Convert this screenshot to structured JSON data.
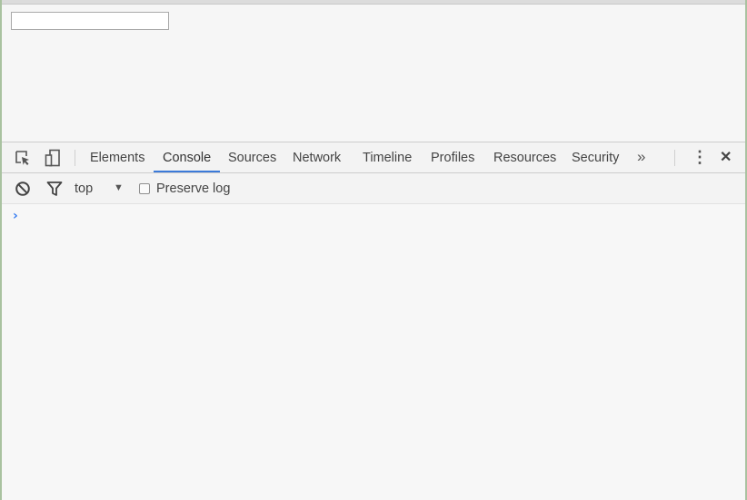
{
  "page": {
    "input_value": ""
  },
  "devtools": {
    "tabs": [
      {
        "label": "Elements",
        "active": false
      },
      {
        "label": "Console",
        "active": true
      },
      {
        "label": "Sources",
        "active": false
      },
      {
        "label": "Network",
        "active": false
      },
      {
        "label": "Timeline",
        "active": false
      },
      {
        "label": "Profiles",
        "active": false
      },
      {
        "label": "Resources",
        "active": false
      },
      {
        "label": "Security",
        "active": false
      }
    ],
    "more_tabs_glyph": "»",
    "menu_glyph": "⋮",
    "close_glyph": "✕",
    "accent_color": "#3b7ad9"
  },
  "console": {
    "context": "top",
    "context_arrow": "▼",
    "preserve_log_label": "Preserve log",
    "preserve_log_checked": false,
    "prompt_glyph": "›",
    "prompt_color": "#367cf1"
  }
}
